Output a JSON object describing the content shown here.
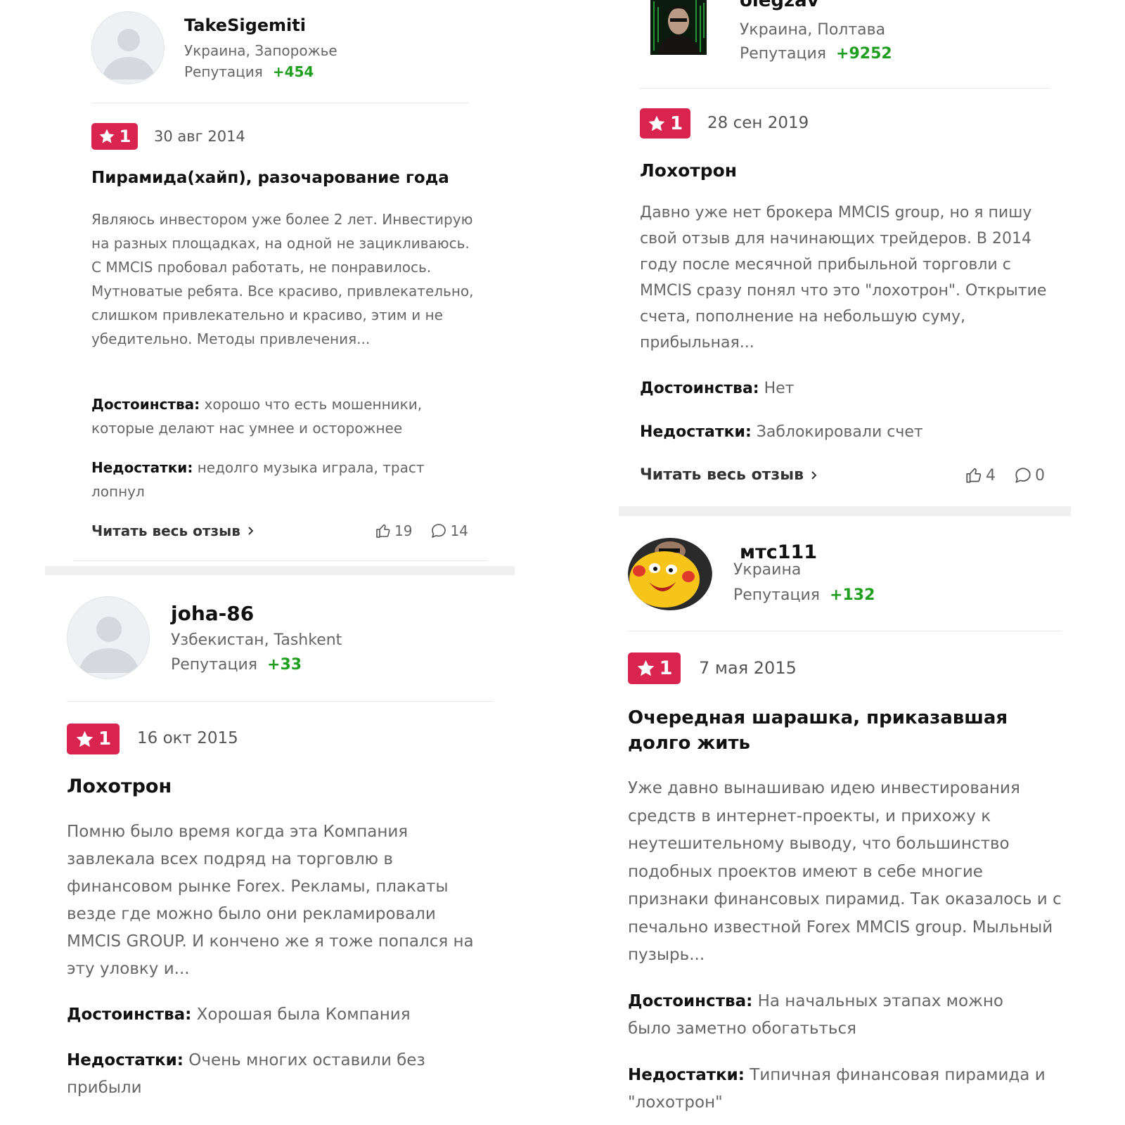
{
  "reviews": [
    {
      "user": {
        "name": "TakeSigemiti",
        "location": "Украина, Запорожье",
        "reputation_label": "Репутация",
        "reputation": "+454"
      },
      "rating": "1",
      "date": "30 авг 2014",
      "title": "Пирамида(хайп), разочарование года",
      "text": "Являюсь инвестором уже более 2 лет. Инвестирую на разных площадках, на одной не зацикливаюсь. С MMCIS пробовал работать, не понравилось. Мутноватые ребята. Все красиво, привлекательно, слишком привлекательно и красиво, этим и не убедительно. Методы привлечения...",
      "pros_label": "Достоинства:",
      "pros": "хорошо что есть мошенники, которые делают нас умнее и осторожнее",
      "cons_label": "Недостатки:",
      "cons": "недолго музыка играла, траст лопнул",
      "read_more": "Читать весь отзыв",
      "likes": "19",
      "comments": "14"
    },
    {
      "user": {
        "name": "joha-86",
        "location": "Узбекистан, Tashkent",
        "reputation_label": "Репутация",
        "reputation": "+33"
      },
      "rating": "1",
      "date": "16 окт 2015",
      "title": "Лохотрон",
      "text": "Помню было время когда эта Компания завлекала всех подряд на торговлю в финансовом рынке Forex. Рекламы, плакаты везде где можно было они рекламировали MMCIS GROUP. И кончено же я тоже попался на эту уловку и...",
      "pros_label": "Достоинства:",
      "pros": "Хорошая была Компания",
      "cons_label": "Недостатки:",
      "cons": "Очень многих оставили без прибыли"
    },
    {
      "user": {
        "name": "olegzav",
        "location": "Украина, Полтава",
        "reputation_label": "Репутация",
        "reputation": "+9252"
      },
      "rating": "1",
      "date": "28 сен 2019",
      "title": "Лохотрон",
      "text": "Давно уже нет брокера MMCIS group, но я пишу свой отзыв для начинающих трейдеров. В 2014 году после месячной прибыльной торговли с MMCIS сразу понял что это \"лохотрон\". Открытие счета, пополнение на небольшую суму, прибыльная...",
      "pros_label": "Достоинства:",
      "pros": "Нет",
      "cons_label": "Недостатки:",
      "cons": "Заблокировали счет",
      "read_more": "Читать весь отзыв",
      "likes": "4",
      "comments": "0"
    },
    {
      "user": {
        "name": "мтс111",
        "location": "Украина",
        "reputation_label": "Репутация",
        "reputation": "+132"
      },
      "rating": "1",
      "date": "7 мая 2015",
      "title": "Очередная шарашка, приказавшая долго жить",
      "text": "Уже давно вынашиваю идею инвестирования средств в интернет-проекты, и прихожу к неутешительному выводу, что большинство подобных проектов имеют в себе многие признаки финансовых пирамид. Так оказалось и с печально известной Forex MMCIS group. Мыльный пузырь...",
      "pros_label": "Достоинства:",
      "pros": "На начальных этапах можно было заметно обогатьться",
      "cons_label": "Недостатки:",
      "cons": "Типичная финансовая пирамида и \"лохотрон\""
    }
  ],
  "colors": {
    "badge": "#d9244f",
    "reputation": "#1f9e1f",
    "separator": "#f0f0f0"
  }
}
